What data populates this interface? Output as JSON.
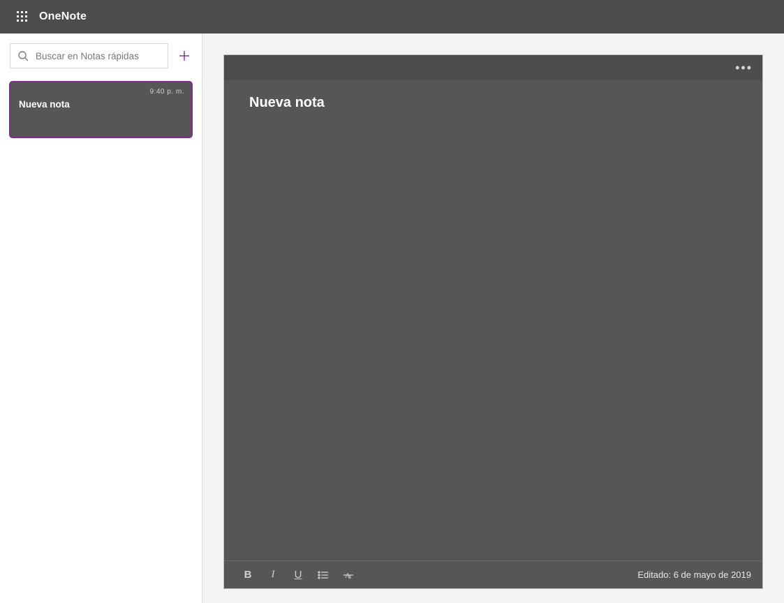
{
  "header": {
    "app_title": "OneNote"
  },
  "sidebar": {
    "search_placeholder": "Buscar en Notas rápidas",
    "add_icon": "plus-icon",
    "notes": [
      {
        "title": "Nueva nota",
        "time": "9:40 p. m."
      }
    ]
  },
  "note": {
    "title": "Nueva nota",
    "more_icon": "more-dots-icon",
    "toolbar": {
      "bold": "B",
      "italic": "I",
      "underline": "U",
      "bullets_icon": "bullet-list-icon",
      "strike_icon": "strikethrough-icon"
    },
    "edited_label": "Editado: 6 de mayo de 2019"
  }
}
